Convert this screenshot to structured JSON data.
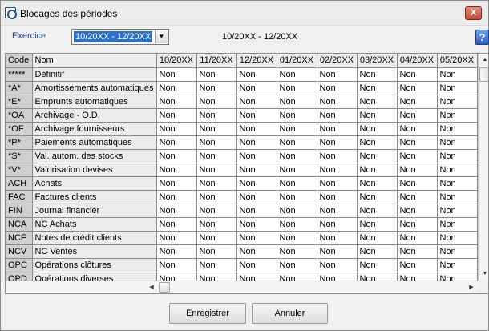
{
  "window": {
    "title": "Blocages des périodes",
    "close_glyph": "X"
  },
  "exercice": {
    "label": "Exercice",
    "selected": "10/20XX - 12/20XX",
    "range_text": "10/20XX - 12/20XX"
  },
  "help_glyph": "?",
  "grid": {
    "headers": {
      "code": "Code",
      "nom": "Nom",
      "periods": [
        "10/20XX",
        "11/20XX",
        "12/20XX",
        "01/20XX",
        "02/20XX",
        "03/20XX",
        "04/20XX",
        "05/20XX"
      ]
    },
    "rows": [
      {
        "code": "*****",
        "nom": "Définitif"
      },
      {
        "code": "*A*",
        "nom": "Amortissements automatiques"
      },
      {
        "code": "*E*",
        "nom": "Emprunts automatiques"
      },
      {
        "code": "*OA",
        "nom": "Archivage - O.D."
      },
      {
        "code": "*OF",
        "nom": "Archivage fournisseurs"
      },
      {
        "code": "*P*",
        "nom": "Paiements automatiques"
      },
      {
        "code": "*S*",
        "nom": "Val. autom. des stocks"
      },
      {
        "code": "*V*",
        "nom": "Valorisation devises"
      },
      {
        "code": "ACH",
        "nom": "Achats"
      },
      {
        "code": "FAC",
        "nom": "Factures clients"
      },
      {
        "code": "FIN",
        "nom": "Journal financier"
      },
      {
        "code": "NCA",
        "nom": "NC Achats"
      },
      {
        "code": "NCF",
        "nom": "Notes de crédit clients"
      },
      {
        "code": "NCV",
        "nom": "NC Ventes"
      },
      {
        "code": "OPC",
        "nom": "Opérations clôtures"
      },
      {
        "code": "OPD",
        "nom": "Opérations diverses"
      }
    ],
    "cell_value": "Non"
  },
  "buttons": {
    "save": "Enregistrer",
    "cancel": "Annuler"
  },
  "icons": {
    "app": "app-logo-icon",
    "close": "close-icon",
    "help": "help-icon",
    "dropdown": "chevron-down-icon"
  }
}
